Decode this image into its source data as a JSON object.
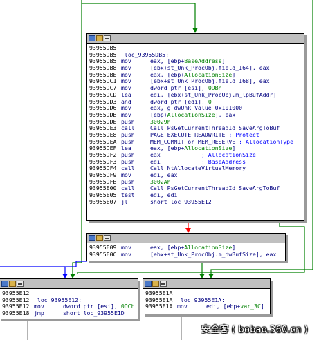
{
  "colors": {
    "edge_green": "#008000",
    "edge_red": "#ff0000",
    "edge_blue": "#0000ff",
    "edge_gray": "#808080",
    "node_header": "#c0c0c0",
    "mnemonic": "#000080",
    "symbol": "#008000",
    "comment": "#0000ff"
  },
  "header_icons": [
    "graph-icon",
    "rename-icon",
    "list-icon"
  ],
  "blocks": {
    "b1": {
      "lines": [
        [
          {
            "t": "93955DB5",
            "c": "ad"
          }
        ],
        [
          {
            "t": "93955DB5",
            "c": "ad"
          },
          {
            "t": " loc_93955DB5:",
            "c": "lb"
          }
        ],
        [
          {
            "t": "93955DB5",
            "c": "ad"
          },
          {
            "t": "mov",
            "c": "mn"
          },
          {
            "t": "eax, [ebp+",
            "c": "op"
          },
          {
            "t": "BaseAddress",
            "c": "nm"
          },
          {
            "t": "]",
            "c": "op"
          }
        ],
        [
          {
            "t": "93955DB8",
            "c": "ad"
          },
          {
            "t": "mov",
            "c": "mn"
          },
          {
            "t": "[ebx+st_Unk_ProcObj.field_164], eax",
            "c": "op"
          }
        ],
        [
          {
            "t": "93955DBE",
            "c": "ad"
          },
          {
            "t": "mov",
            "c": "mn"
          },
          {
            "t": "eax, [ebp+",
            "c": "op"
          },
          {
            "t": "AllocationSize",
            "c": "nm"
          },
          {
            "t": "]",
            "c": "op"
          }
        ],
        [
          {
            "t": "93955DC1",
            "c": "ad"
          },
          {
            "t": "mov",
            "c": "mn"
          },
          {
            "t": "[ebx+st_Unk_ProcObj.field_168], eax",
            "c": "op"
          }
        ],
        [
          {
            "t": "93955DC7",
            "c": "ad"
          },
          {
            "t": "mov",
            "c": "mn"
          },
          {
            "t": "dword ptr [esi], ",
            "c": "op"
          },
          {
            "t": "0DBh",
            "c": "nm"
          }
        ],
        [
          {
            "t": "93955DCD",
            "c": "ad"
          },
          {
            "t": "lea",
            "c": "mn"
          },
          {
            "t": "edi, [ebx+st_Unk_ProcObj.m_lpBufAddr]",
            "c": "op"
          }
        ],
        [
          {
            "t": "93955DD3",
            "c": "ad"
          },
          {
            "t": "and",
            "c": "mn"
          },
          {
            "t": "dword ptr [edi], ",
            "c": "op"
          },
          {
            "t": "0",
            "c": "nm"
          }
        ],
        [
          {
            "t": "93955DD6",
            "c": "ad"
          },
          {
            "t": "mov",
            "c": "mn"
          },
          {
            "t": "eax, g_dwUnk_Value_0x101000",
            "c": "op"
          }
        ],
        [
          {
            "t": "93955DDB",
            "c": "ad"
          },
          {
            "t": "mov",
            "c": "mn"
          },
          {
            "t": "[ebp+",
            "c": "op"
          },
          {
            "t": "AllocationSize",
            "c": "nm"
          },
          {
            "t": "], eax",
            "c": "op"
          }
        ],
        [
          {
            "t": "93955DDE",
            "c": "ad"
          },
          {
            "t": "push",
            "c": "mn"
          },
          {
            "t": "30029h",
            "c": "nm"
          }
        ],
        [
          {
            "t": "93955DE3",
            "c": "ad"
          },
          {
            "t": "call",
            "c": "mn"
          },
          {
            "t": "Call_PsGetCurrentThreadId_SaveArgToBuf",
            "c": "op"
          }
        ],
        [
          {
            "t": "93955DE8",
            "c": "ad"
          },
          {
            "t": "push",
            "c": "mn"
          },
          {
            "t": "PAGE_EXECUTE_READWRITE",
            "c": "op"
          },
          {
            "t": " ; Protect",
            "c": "cm"
          }
        ],
        [
          {
            "t": "93955DEA",
            "c": "ad"
          },
          {
            "t": "push",
            "c": "mn"
          },
          {
            "t": "MEM_COMMIT or MEM_RESERVE",
            "c": "op"
          },
          {
            "t": " ; AllocationType",
            "c": "cm"
          }
        ],
        [
          {
            "t": "93955DEF",
            "c": "ad"
          },
          {
            "t": "lea",
            "c": "mn"
          },
          {
            "t": "eax, [ebp+",
            "c": "op"
          },
          {
            "t": "AllocationSize",
            "c": "nm"
          },
          {
            "t": "]",
            "c": "op"
          }
        ],
        [
          {
            "t": "93955DF2",
            "c": "ad"
          },
          {
            "t": "push",
            "c": "mn"
          },
          {
            "t": "eax            ",
            "c": "op"
          },
          {
            "t": "; AllocationSize",
            "c": "cm"
          }
        ],
        [
          {
            "t": "93955DF3",
            "c": "ad"
          },
          {
            "t": "push",
            "c": "mn"
          },
          {
            "t": "edi            ",
            "c": "op"
          },
          {
            "t": "; BaseAddress",
            "c": "cm"
          }
        ],
        [
          {
            "t": "93955DF4",
            "c": "ad"
          },
          {
            "t": "call",
            "c": "mn"
          },
          {
            "t": "Call_NtAllocateVirtualMemory",
            "c": "op"
          }
        ],
        [
          {
            "t": "93955DF9",
            "c": "ad"
          },
          {
            "t": "mov",
            "c": "mn"
          },
          {
            "t": "edi, eax",
            "c": "op"
          }
        ],
        [
          {
            "t": "93955DFB",
            "c": "ad"
          },
          {
            "t": "push",
            "c": "mn"
          },
          {
            "t": "3002Ah",
            "c": "nm"
          }
        ],
        [
          {
            "t": "93955E00",
            "c": "ad"
          },
          {
            "t": "call",
            "c": "mn"
          },
          {
            "t": "Call_PsGetCurrentThreadId_SaveArgToBuf",
            "c": "op"
          }
        ],
        [
          {
            "t": "93955E05",
            "c": "ad"
          },
          {
            "t": "test",
            "c": "mn"
          },
          {
            "t": "edi, edi",
            "c": "op"
          }
        ],
        [
          {
            "t": "93955E07",
            "c": "ad"
          },
          {
            "t": "jl",
            "c": "mn"
          },
          {
            "t": "short loc_93955E12",
            "c": "op"
          }
        ]
      ]
    },
    "b2": {
      "lines": [
        [
          {
            "t": "93955E09",
            "c": "ad"
          },
          {
            "t": "mov",
            "c": "mn"
          },
          {
            "t": "eax, [ebp+",
            "c": "op"
          },
          {
            "t": "AllocationSize",
            "c": "nm"
          },
          {
            "t": "]",
            "c": "op"
          }
        ],
        [
          {
            "t": "93955E0C",
            "c": "ad"
          },
          {
            "t": "mov",
            "c": "mn"
          },
          {
            "t": "[ebx+st_Unk_ProcObj.m_dwBufSize], eax",
            "c": "op"
          }
        ]
      ]
    },
    "b3": {
      "lines": [
        [
          {
            "t": "93955E12",
            "c": "ad"
          }
        ],
        [
          {
            "t": "93955E12",
            "c": "ad"
          },
          {
            "t": " loc_93955E12:",
            "c": "lb"
          }
        ],
        [
          {
            "t": "93955E12",
            "c": "ad"
          },
          {
            "t": "mov",
            "c": "mn"
          },
          {
            "t": "dword ptr [esi], ",
            "c": "op"
          },
          {
            "t": "0DCh",
            "c": "nm"
          }
        ],
        [
          {
            "t": "93955E18",
            "c": "ad"
          },
          {
            "t": "jmp",
            "c": "mn"
          },
          {
            "t": "short loc_93955E1D",
            "c": "op"
          }
        ]
      ]
    },
    "b4": {
      "lines": [
        [
          {
            "t": "93955E1A",
            "c": "ad"
          }
        ],
        [
          {
            "t": "93955E1A",
            "c": "ad"
          },
          {
            "t": " loc_93955E1A:",
            "c": "lb"
          }
        ],
        [
          {
            "t": "93955E1A",
            "c": "ad"
          },
          {
            "t": "mov",
            "c": "mn"
          },
          {
            "t": "edi, [ebp+",
            "c": "op"
          },
          {
            "t": "var_3C",
            "c": "nm"
          },
          {
            "t": "]",
            "c": "op"
          }
        ]
      ]
    }
  },
  "watermark": "安全客 ( bobao.360.cn )"
}
